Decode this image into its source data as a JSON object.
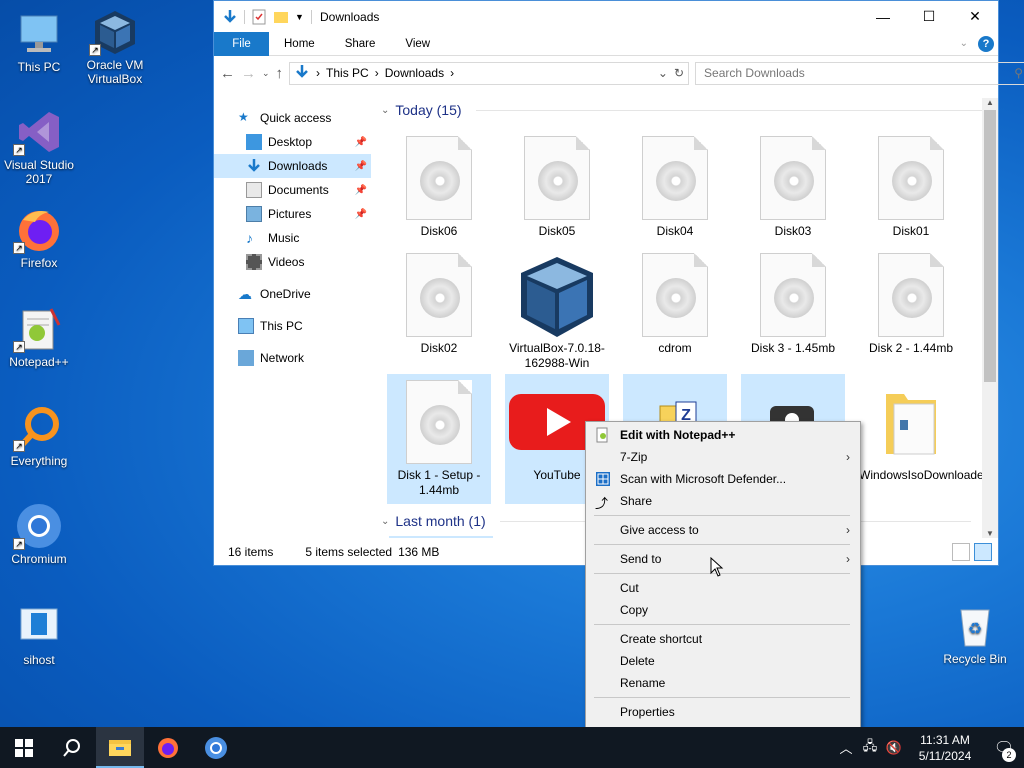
{
  "desktop": {
    "icons": [
      {
        "label": "This PC",
        "icon": "this-pc-icon"
      },
      {
        "label": "Oracle VM VirtualBox",
        "icon": "virtualbox-icon"
      },
      {
        "label": "Visual Studio 2017",
        "icon": "visual-studio-icon"
      },
      {
        "label": "Firefox",
        "icon": "firefox-icon"
      },
      {
        "label": "Notepad++",
        "icon": "notepadpp-icon"
      },
      {
        "label": "Everything",
        "icon": "everything-icon"
      },
      {
        "label": "Chromium",
        "icon": "chromium-icon"
      },
      {
        "label": "sihost",
        "icon": "sihost-icon"
      },
      {
        "label": "Recycle Bin",
        "icon": "recycle-bin-icon"
      }
    ]
  },
  "window": {
    "title": "Downloads",
    "controls": {
      "minimize": "—",
      "maximize": "☐",
      "close": "✕"
    },
    "ribbon": {
      "file": "File",
      "home": "Home",
      "share": "Share",
      "view": "View"
    },
    "address": {
      "segments": [
        "This PC",
        "Downloads"
      ]
    },
    "search": {
      "placeholder": "Search Downloads"
    },
    "nav": {
      "quick_access": "Quick access",
      "desktop": "Desktop",
      "downloads": "Downloads",
      "documents": "Documents",
      "pictures": "Pictures",
      "music": "Music",
      "videos": "Videos",
      "onedrive": "OneDrive",
      "this_pc": "This PC",
      "network": "Network"
    },
    "groups": {
      "today": "Today (15)",
      "last_month": "Last month (1)"
    },
    "files": [
      {
        "name": "Disk06",
        "selected": false
      },
      {
        "name": "Disk05",
        "selected": false
      },
      {
        "name": "Disk04",
        "selected": false
      },
      {
        "name": "Disk03",
        "selected": false
      },
      {
        "name": "Disk01",
        "selected": false
      },
      {
        "name": "Disk02",
        "selected": false
      },
      {
        "name": "VirtualBox-7.0.18-162988-Win",
        "selected": false
      },
      {
        "name": "cdrom",
        "selected": false
      },
      {
        "name": "Disk 3 - 1.45mb",
        "selected": false
      },
      {
        "name": "Disk 2 - 1.44mb",
        "selected": false
      },
      {
        "name": "Disk 1 - Setup - 1.44mb",
        "selected": true
      },
      {
        "name": "YouTube",
        "selected": true
      },
      {
        "name": "WindowsIsoDownloader",
        "selected": false
      }
    ],
    "status": {
      "items": "16 items",
      "selected": "5 items selected",
      "size": "136 MB"
    }
  },
  "context_menu": {
    "items": [
      {
        "label": "Edit with Notepad++",
        "bold": true
      },
      {
        "label": "7-Zip",
        "submenu": true
      },
      {
        "label": "Scan with Microsoft Defender..."
      },
      {
        "label": "Share"
      },
      {
        "label": "Give access to",
        "submenu": true
      },
      {
        "label": "Send to",
        "submenu": true
      },
      {
        "label": "Cut"
      },
      {
        "label": "Copy"
      },
      {
        "label": "Create shortcut"
      },
      {
        "label": "Delete"
      },
      {
        "label": "Rename"
      },
      {
        "label": "Properties"
      }
    ]
  },
  "taskbar": {
    "clock_time": "11:31 AM",
    "clock_date": "5/11/2024",
    "notification_count": "2"
  },
  "colors": {
    "accent": "#1979ca",
    "selection": "#cce8ff",
    "taskbar": "#101822"
  }
}
